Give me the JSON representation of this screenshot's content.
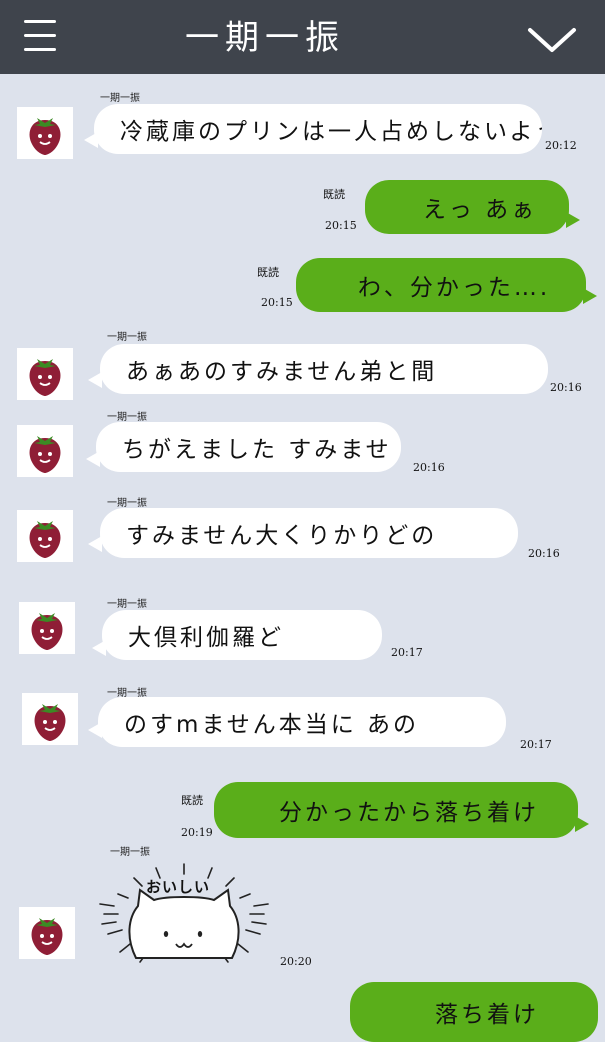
{
  "header": {
    "title": "一期一振"
  },
  "messages": [
    {
      "sender": "一期一振",
      "text": "冷蔵庫のプリンは一人占めしないように",
      "time": "20:12"
    },
    {
      "read": "既読",
      "time": "20:15",
      "text": "えっ あぁ"
    },
    {
      "read": "既読",
      "time": "20:15",
      "text": "わ、分かった…."
    },
    {
      "sender": "一期一振",
      "text": "あぁあのすみません弟と間",
      "time": "20:16"
    },
    {
      "sender": "一期一振",
      "text": "ちがえました すみませ",
      "time": "20:16"
    },
    {
      "sender": "一期一振",
      "text": "すみません大くりかりどの",
      "time": "20:16"
    },
    {
      "sender": "一期一振",
      "text": "大倶利伽羅ど",
      "time": "20:17"
    },
    {
      "sender": "一期一振",
      "text": "のすmません本当に あの",
      "time": "20:17"
    },
    {
      "read": "既読",
      "time": "20:19",
      "text": "分かったから落ち着け"
    },
    {
      "sender": "一期一振",
      "sticker_text": "おいしい",
      "time": "20:20"
    },
    {
      "text": "落ち着け"
    }
  ],
  "colors": {
    "header_bg": "#3f444c",
    "chat_bg": "#dde2ec",
    "outgoing_bubble": "#5aae1a",
    "incoming_bubble": "#ffffff"
  },
  "icons": {
    "menu": "hamburger-icon",
    "collapse": "chevron-down-icon",
    "avatar": "strawberry-icon"
  }
}
